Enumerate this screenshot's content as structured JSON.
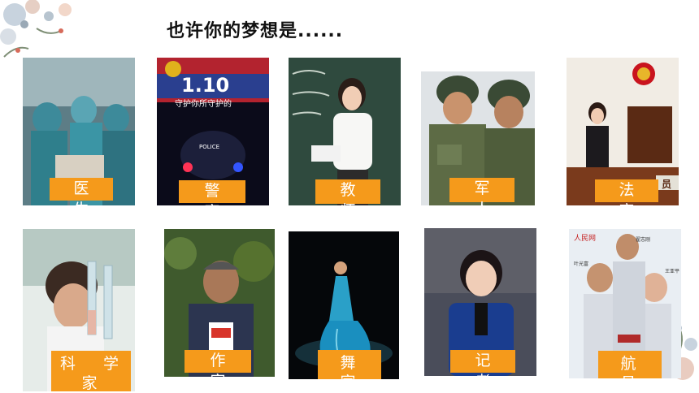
{
  "title": "也许你的梦想是......",
  "photo_caption_texts": {
    "police_text_1": "1.10",
    "police_text_2": "守护你所守护的",
    "police_badge": "POLICE",
    "judge_bench": "员",
    "astronaut_brand": "人民网",
    "astronaut_names": [
      "翟志刚",
      "叶光富",
      "王亚平"
    ]
  },
  "row1": [
    {
      "label": "医 生"
    },
    {
      "label": "警 察"
    },
    {
      "label": "教 师"
    },
    {
      "label": "军 人"
    },
    {
      "label": "法 官"
    }
  ],
  "row2": [
    {
      "label_line1": "科 学",
      "label_line2": "家"
    },
    {
      "label": "作 家"
    },
    {
      "label_line1": "舞 蹈",
      "label_line2": "家"
    },
    {
      "label": "记 者"
    },
    {
      "label_line1": "航 天",
      "label_line2": "员"
    }
  ],
  "colors": {
    "label_bg": "#f59a1b",
    "label_text": "#ffffff"
  }
}
